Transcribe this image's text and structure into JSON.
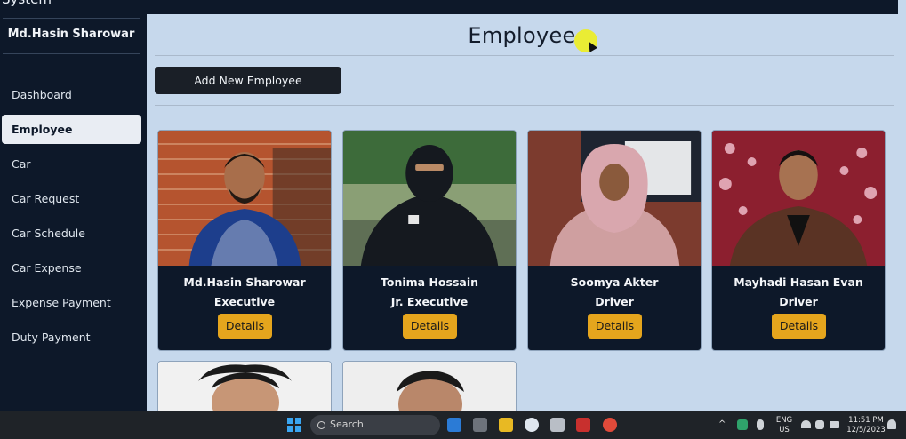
{
  "app": {
    "system_title": "System",
    "user": "Md.Hasin Sharowar"
  },
  "sidebar": {
    "items": [
      {
        "label": "Dashboard",
        "active": false
      },
      {
        "label": "Employee",
        "active": true
      },
      {
        "label": "Car",
        "active": false
      },
      {
        "label": "Car Request",
        "active": false
      },
      {
        "label": "Car Schedule",
        "active": false
      },
      {
        "label": "Car Expense",
        "active": false
      },
      {
        "label": "Expense Payment",
        "active": false
      },
      {
        "label": "Duty Payment",
        "active": false
      }
    ]
  },
  "main": {
    "title": "Employee",
    "add_button": "Add New Employee",
    "details_label": "Details",
    "employees": [
      {
        "name": "Md.Hasin Sharowar",
        "role": "Executive"
      },
      {
        "name": "Tonima Hossain",
        "role": "Jr. Executive"
      },
      {
        "name": "Soomya Akter",
        "role": "Driver"
      },
      {
        "name": "Mayhadi Hasan Evan",
        "role": "Driver"
      }
    ]
  },
  "taskbar": {
    "search_placeholder": "Search",
    "language": "ENG",
    "region": "US",
    "time": "11:51 PM",
    "date": "12/5/2023"
  },
  "colors": {
    "sidebar_bg": "#0d1829",
    "main_bg": "#c6d8ec",
    "accent_button": "#e5a51d",
    "card_bg": "#0d1829"
  }
}
